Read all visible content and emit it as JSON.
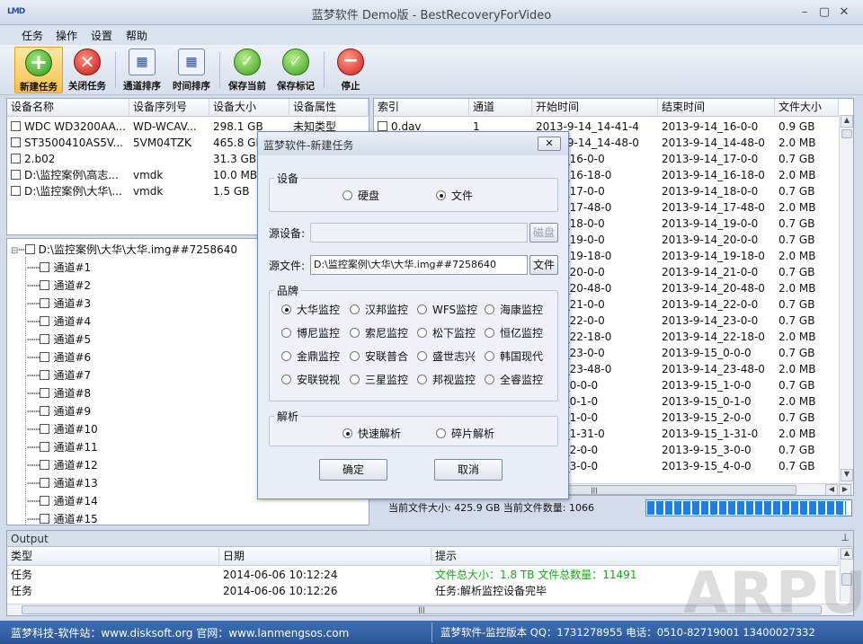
{
  "app": {
    "logo_text": "LMD",
    "title": "蓝梦软件 Demo版 - BestRecoveryForVideo",
    "min": "–",
    "max": "▢",
    "close": "✕"
  },
  "menu": [
    "任务",
    "操作",
    "设置",
    "帮助"
  ],
  "toolbar": [
    {
      "label": "新建任务",
      "icon": "plus-icon"
    },
    {
      "label": "关闭任务",
      "icon": "close-icon"
    },
    {
      "label": "通道排序",
      "icon": "calendar-icon"
    },
    {
      "label": "时间排序",
      "icon": "calendar-icon"
    },
    {
      "label": "保存当前",
      "icon": "check-icon"
    },
    {
      "label": "保存标记",
      "icon": "check-icon"
    },
    {
      "label": "停止",
      "icon": "stop-icon"
    }
  ],
  "devices": {
    "columns": [
      "设备名称",
      "设备序列号",
      "设备大小",
      "设备属性"
    ],
    "rows": [
      [
        "WDC WD3200AA...",
        "WD-WCAV...",
        "298.1 GB",
        "未知类型"
      ],
      [
        "ST3500410AS5V...",
        "5VM04TZK",
        "465.8 GB",
        ""
      ],
      [
        "2.b02",
        "",
        "31.3 GB",
        ""
      ],
      [
        "D:\\监控案例\\高志...",
        "vmdk",
        "10.0 MB",
        ""
      ],
      [
        "D:\\监控案例\\大华\\...",
        "vmdk",
        "1.5 GB",
        ""
      ]
    ]
  },
  "tree": {
    "root": "D:\\监控案例\\大华\\大华.img##7258640",
    "channels": [
      "通道#1",
      "通道#2",
      "通道#3",
      "通道#4",
      "通道#5",
      "通道#6",
      "通道#7",
      "通道#8",
      "通道#9",
      "通道#10",
      "通道#11",
      "通道#12",
      "通道#13",
      "通道#14",
      "通道#15"
    ]
  },
  "files": {
    "columns": [
      "索引",
      "通道",
      "开始时间",
      "结束时间",
      "文件大小"
    ],
    "rows": [
      [
        "0.dav",
        "1",
        "2013-9-14_14-41-4",
        "2013-9-14_16-0-0",
        "0.9 GB"
      ],
      [
        "",
        "",
        "2013-9-14_14-48-0",
        "2013-9-14_14-48-0",
        "2.0 MB"
      ],
      [
        "",
        "",
        "-9-14_16-0-0",
        "2013-9-14_17-0-0",
        "0.7 GB"
      ],
      [
        "",
        "",
        "-9-14_16-18-0",
        "2013-9-14_16-18-0",
        "2.0 MB"
      ],
      [
        "",
        "",
        "-9-14_17-0-0",
        "2013-9-14_18-0-0",
        "0.7 GB"
      ],
      [
        "",
        "",
        "-9-14_17-48-0",
        "2013-9-14_17-48-0",
        "2.0 MB"
      ],
      [
        "",
        "",
        "-9-14_18-0-0",
        "2013-9-14_19-0-0",
        "0.7 GB"
      ],
      [
        "",
        "",
        "-9-14_19-0-0",
        "2013-9-14_20-0-0",
        "0.7 GB"
      ],
      [
        "",
        "",
        "-9-14_19-18-0",
        "2013-9-14_19-18-0",
        "2.0 MB"
      ],
      [
        "",
        "",
        "-9-14_20-0-0",
        "2013-9-14_21-0-0",
        "0.7 GB"
      ],
      [
        "",
        "",
        "-9-14_20-48-0",
        "2013-9-14_20-48-0",
        "2.0 MB"
      ],
      [
        "",
        "",
        "-9-14_21-0-0",
        "2013-9-14_22-0-0",
        "0.7 GB"
      ],
      [
        "",
        "",
        "-9-14_22-0-0",
        "2013-9-14_23-0-0",
        "0.7 GB"
      ],
      [
        "",
        "",
        "-9-14_22-18-0",
        "2013-9-14_22-18-0",
        "2.0 MB"
      ],
      [
        "",
        "",
        "-9-14_23-0-0",
        "2013-9-15_0-0-0",
        "0.7 GB"
      ],
      [
        "",
        "",
        "-9-14_23-48-0",
        "2013-9-14_23-48-0",
        "2.0 MB"
      ],
      [
        "",
        "",
        "-9-15_0-0-0",
        "2013-9-15_1-0-0",
        "0.7 GB"
      ],
      [
        "",
        "",
        "-9-15_0-1-0",
        "2013-9-15_0-1-0",
        "2.0 MB"
      ],
      [
        "",
        "",
        "-9-15_1-0-0",
        "2013-9-15_2-0-0",
        "0.7 GB"
      ],
      [
        "",
        "",
        "-9-15_1-31-0",
        "2013-9-15_1-31-0",
        "2.0 MB"
      ],
      [
        "",
        "",
        "-9-15_2-0-0",
        "2013-9-15_3-0-0",
        "0.7 GB"
      ],
      [
        "",
        "",
        "-9-15_3-0-0",
        "2013-9-15_4-0-0",
        "0.7 GB"
      ]
    ],
    "summary": "当前文件大小: 425.9 GB 当前文件数量: 1066",
    "progress": 0.98
  },
  "output": {
    "title": "Output",
    "columns": [
      "类型",
      "日期",
      "提示"
    ],
    "rows": [
      {
        "type": "任务",
        "date": "2014-06-06 10:12:24",
        "msg": "文件总大小：1.8 TB  文件总数量：11491",
        "color": "#1aa51a"
      },
      {
        "type": "任务",
        "date": "2014-06-06 10:12:26",
        "msg": "任务:解析监控设备完毕",
        "color": "#111111"
      }
    ]
  },
  "status": {
    "left": "蓝梦科技-软件站：www.disksoft.org  官网：www.lanmengsos.com",
    "right": "蓝梦软件-监控版本  QQ：1731278955  电话：0510-82719001 13400027332"
  },
  "watermark": "ARPUN",
  "dialog": {
    "title": "蓝梦软件-新建任务",
    "device_group": "设备",
    "device_opts": [
      {
        "label": "硬盘",
        "on": false
      },
      {
        "label": "文件",
        "on": true
      }
    ],
    "source_device_label": "源设备:",
    "source_device_value": "",
    "disk_btn": "磁盘",
    "source_file_label": "源文件:",
    "source_file_value": "D:\\监控案例\\大华\\大华.img##7258640",
    "file_btn": "文件",
    "brand_group": "品牌",
    "brands": [
      "大华监控",
      "汉邦监控",
      "WFS监控",
      "海康监控",
      "博尼监控",
      "索尼监控",
      "松下监控",
      "恒亿监控",
      "金鼎监控",
      "安联普合",
      "盛世志兴",
      "韩国现代",
      "安联锐视",
      "三星监控",
      "邦视监控",
      "全睿监控"
    ],
    "brand_selected": 0,
    "parse_group": "解析",
    "parse_opts": [
      {
        "label": "快速解析",
        "on": true
      },
      {
        "label": "碎片解析",
        "on": false
      }
    ],
    "ok": "确定",
    "cancel": "取消"
  }
}
